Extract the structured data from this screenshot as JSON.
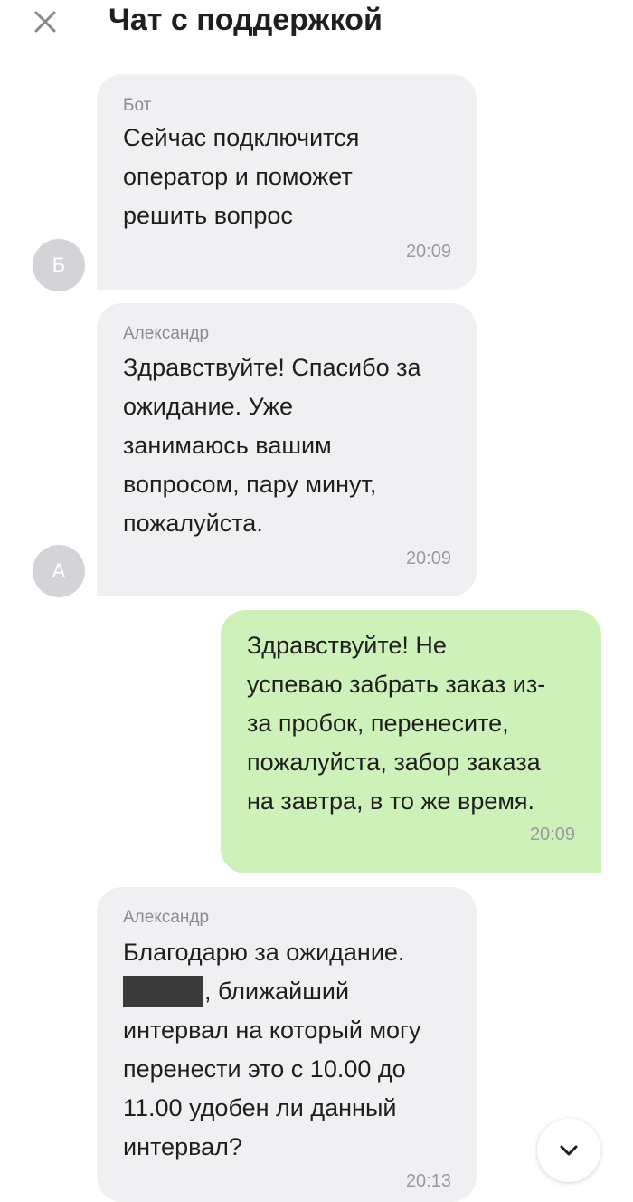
{
  "header": {
    "title": "Чат с поддержкой",
    "close_icon": "close-icon"
  },
  "messages": [
    {
      "direction": "incoming",
      "sender": "Бот",
      "avatar": "Б",
      "lines": [
        "Сейчас подключится",
        "оператор и поможет",
        "решить вопрос"
      ],
      "time": "20:09"
    },
    {
      "direction": "incoming",
      "sender": "Александр",
      "avatar": "А",
      "lines": [
        "Здравствуйте! Спасибо за",
        "ожидание. Уже",
        "занимаюсь вашим",
        "вопросом, пару минут,",
        "пожалуйста."
      ],
      "time": "20:09"
    },
    {
      "direction": "outgoing",
      "lines": [
        "Здравствуйте! Не",
        "успеваю забрать заказ из-",
        "за пробок, перенесите,",
        "пожалуйста, забор заказа",
        "на завтра, в то же время."
      ],
      "time": "20:09"
    },
    {
      "direction": "incoming",
      "sender": "Александр",
      "lines": [
        "Благодарю за ожидание.",
        ", ближайший",
        "интервал на который могу",
        "перенести это с 10.00 до",
        "11.00 удобен ли данный",
        "интервал?"
      ],
      "redacted_name": true,
      "time": "20:13"
    }
  ],
  "scroll_button": {
    "icon": "chevron-down-icon"
  },
  "colors": {
    "incoming_bubble": "#f0f0f2",
    "outgoing_bubble": "#cdf1b9",
    "avatar_bg": "#d4d4d8",
    "secondary_text": "#8c8c8f"
  }
}
